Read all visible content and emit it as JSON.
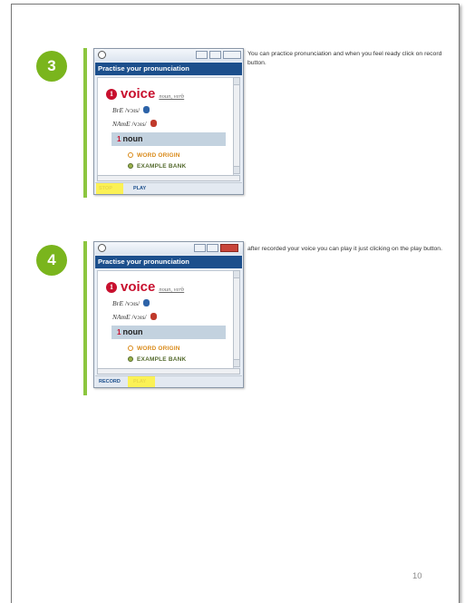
{
  "steps": [
    {
      "number": "3",
      "window": {
        "header": "Practise your pronunciation",
        "headword": "voice",
        "sense_number": "1",
        "pos": "noun, verb",
        "pron_bre_label": "BrE",
        "pron_bre": "/vɔɪs/",
        "pron_name_label": "NAmE",
        "pron_name": "/vɔɪs/",
        "sense_label": "noun",
        "sense_num": "1",
        "option_origin": "WORD ORIGIN",
        "option_bank": "EXAMPLE BANK",
        "record_label": "STOP",
        "play_label": "PLAY",
        "highlighted": "record"
      },
      "caption": "You can practice pronunciation and when you feel ready click on record button."
    },
    {
      "number": "4",
      "window": {
        "header": "Practise your pronunciation",
        "headword": "voice",
        "sense_number": "1",
        "pos": "noun, verb",
        "pron_bre_label": "BrE",
        "pron_bre": "/vɔɪs/",
        "pron_name_label": "NAmE",
        "pron_name": "/vɔɪs/",
        "sense_label": "noun",
        "sense_num": "1",
        "option_origin": "WORD ORIGIN",
        "option_bank": "EXAMPLE BANK",
        "record_label": "RECORD",
        "play_label": "PLAY",
        "highlighted": "play"
      },
      "caption": "after recorded your voice you can play it just clicking on the play button."
    }
  ],
  "page_number": "10",
  "colors": {
    "accent_green": "#8cc63f",
    "badge_green": "#7ab51d",
    "header_blue": "#1c4f8c",
    "headword_red": "#c8102e",
    "highlight_yellow": "#fff23a"
  }
}
